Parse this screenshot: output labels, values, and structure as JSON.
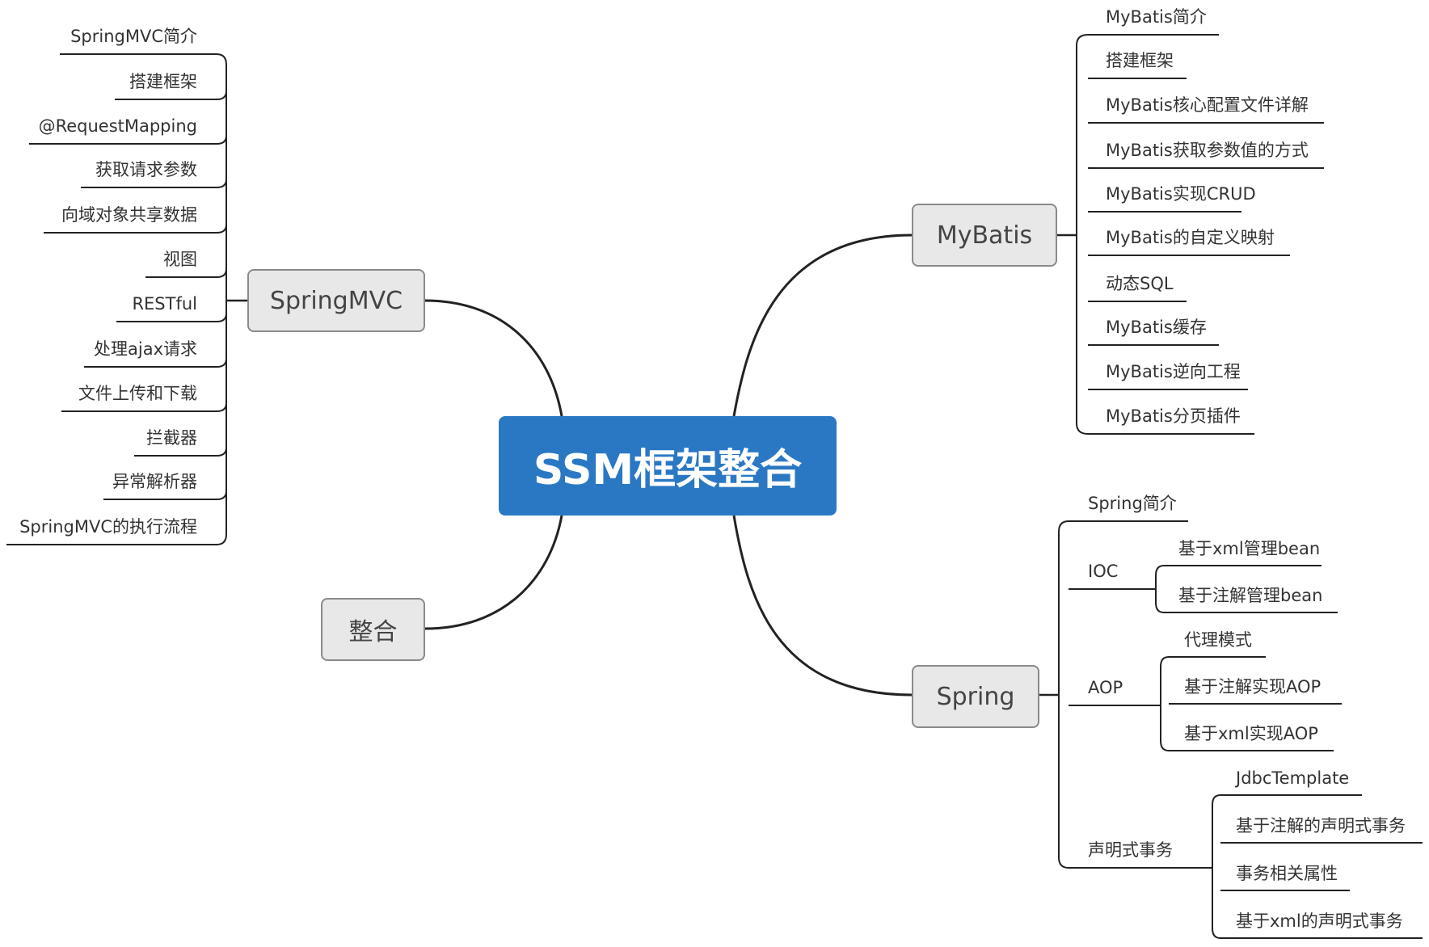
{
  "center": "SSM框架整合",
  "branches": {
    "springmvc": {
      "label": "SpringMVC",
      "items": [
        "SpringMVC简介",
        "搭建框架",
        "@RequestMapping",
        "获取请求参数",
        "向域对象共享数据",
        "视图",
        "RESTful",
        "处理ajax请求",
        "文件上传和下载",
        "拦截器",
        "异常解析器",
        "SpringMVC的执行流程"
      ]
    },
    "zhenghe": {
      "label": "整合"
    },
    "mybatis": {
      "label": "MyBatis",
      "items": [
        "MyBatis简介",
        "搭建框架",
        "MyBatis核心配置文件详解",
        "MyBatis获取参数值的方式",
        "MyBatis实现CRUD",
        "MyBatis的自定义映射",
        "动态SQL",
        "MyBatis缓存",
        "MyBatis逆向工程",
        "MyBatis分页插件"
      ]
    },
    "spring": {
      "label": "Spring",
      "intro": "Spring简介",
      "ioc": {
        "label": "IOC",
        "items": [
          "基于xml管理bean",
          "基于注解管理bean"
        ]
      },
      "aop": {
        "label": "AOP",
        "items": [
          "代理模式",
          "基于注解实现AOP",
          "基于xml实现AOP"
        ]
      },
      "tx": {
        "label": "声明式事务",
        "items": [
          "JdbcTemplate",
          "基于注解的声明式事务",
          "事务相关属性",
          "基于xml的声明式事务"
        ]
      }
    }
  }
}
